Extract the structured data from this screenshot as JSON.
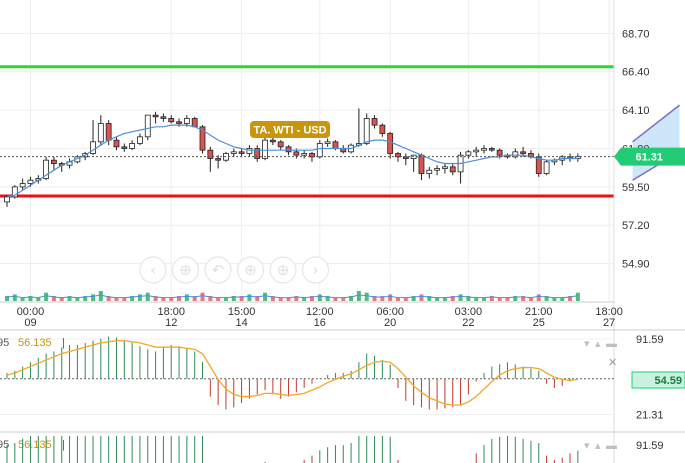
{
  "chart_data": {
    "type": "candlestick",
    "title": "TA. WTI - USD",
    "price_axis": {
      "ticks": [
        "68.70",
        "66.40",
        "64.10",
        "61.80",
        "59.50",
        "57.20",
        "54.90"
      ],
      "tick_values": [
        68.7,
        66.4,
        64.1,
        61.8,
        59.5,
        57.2,
        54.9
      ],
      "ylim": [
        52.6,
        70.7
      ],
      "current_price": "61.31",
      "current_value": 61.31
    },
    "time_axis": {
      "labels": [
        {
          "time": "00:00",
          "date": "09",
          "bar": 3
        },
        {
          "time": "18:00",
          "date": "12",
          "bar": 21
        },
        {
          "time": "15:00",
          "date": "14",
          "bar": 30
        },
        {
          "time": "12:00",
          "date": "16",
          "bar": 40
        },
        {
          "time": "06:00",
          "date": "20",
          "bar": 49
        },
        {
          "time": "03:00",
          "date": "22",
          "bar": 59
        },
        {
          "time": "21:00",
          "date": "25",
          "bar": 68
        },
        {
          "time": "18:00",
          "date": "27",
          "bar": 77
        }
      ]
    },
    "levels": [
      {
        "name": "resistance",
        "value": 66.7,
        "color": "#22dd22"
      },
      {
        "name": "support",
        "value": 58.95,
        "color": "#ee1111"
      }
    ],
    "candles": [
      [
        58.6,
        59.0,
        58.3,
        58.9
      ],
      [
        58.9,
        59.6,
        58.8,
        59.5
      ],
      [
        59.5,
        60.0,
        59.3,
        59.7
      ],
      [
        59.7,
        60.1,
        59.5,
        59.9
      ],
      [
        59.9,
        60.2,
        59.7,
        60.0
      ],
      [
        60.0,
        61.3,
        59.9,
        61.1
      ],
      [
        61.1,
        61.3,
        60.5,
        60.9
      ],
      [
        60.9,
        61.0,
        60.4,
        60.8
      ],
      [
        60.8,
        61.2,
        60.6,
        61.0
      ],
      [
        61.0,
        61.4,
        60.9,
        61.3
      ],
      [
        61.3,
        61.6,
        61.1,
        61.5
      ],
      [
        61.5,
        63.5,
        61.4,
        62.2
      ],
      [
        62.2,
        63.8,
        62.0,
        63.3
      ],
      [
        63.3,
        63.5,
        62.0,
        62.3
      ],
      [
        62.3,
        62.5,
        61.7,
        61.9
      ],
      [
        61.9,
        62.1,
        61.6,
        61.8
      ],
      [
        61.8,
        62.3,
        61.7,
        62.1
      ],
      [
        62.1,
        62.7,
        62.0,
        62.5
      ],
      [
        62.5,
        62.9,
        62.3,
        63.8
      ],
      [
        63.8,
        64.0,
        63.3,
        63.7
      ],
      [
        63.7,
        63.9,
        63.4,
        63.6
      ],
      [
        63.6,
        63.8,
        63.3,
        63.4
      ],
      [
        63.4,
        63.6,
        63.1,
        63.3
      ],
      [
        63.3,
        63.8,
        63.1,
        63.6
      ],
      [
        63.6,
        63.7,
        63.2,
        63.1
      ],
      [
        63.1,
        63.2,
        61.5,
        61.7
      ],
      [
        61.7,
        61.9,
        60.4,
        61.2
      ],
      [
        61.2,
        61.4,
        60.6,
        61.1
      ],
      [
        61.1,
        61.6,
        61.0,
        61.5
      ],
      [
        61.5,
        61.8,
        61.3,
        61.6
      ],
      [
        61.6,
        61.8,
        61.3,
        61.5
      ],
      [
        61.5,
        62.0,
        61.3,
        61.8
      ],
      [
        61.8,
        62.0,
        61.0,
        61.2
      ],
      [
        61.2,
        62.5,
        61.1,
        62.3
      ],
      [
        62.3,
        62.6,
        62.0,
        62.2
      ],
      [
        62.2,
        62.3,
        61.7,
        61.9
      ],
      [
        61.9,
        62.0,
        61.4,
        61.6
      ],
      [
        61.6,
        61.8,
        61.2,
        61.4
      ],
      [
        61.4,
        61.7,
        61.2,
        61.5
      ],
      [
        61.5,
        61.6,
        61.0,
        61.3
      ],
      [
        61.3,
        62.3,
        61.2,
        62.1
      ],
      [
        62.1,
        62.4,
        61.9,
        62.2
      ],
      [
        62.2,
        62.3,
        61.7,
        61.8
      ],
      [
        61.8,
        62.0,
        61.5,
        61.6
      ],
      [
        61.6,
        62.1,
        61.5,
        62.0
      ],
      [
        62.0,
        64.2,
        61.9,
        62.1
      ],
      [
        62.1,
        63.9,
        62.0,
        63.6
      ],
      [
        63.6,
        63.8,
        63.0,
        63.2
      ],
      [
        63.2,
        63.3,
        62.5,
        62.7
      ],
      [
        62.7,
        62.8,
        61.2,
        61.5
      ],
      [
        61.5,
        61.6,
        61.0,
        61.3
      ],
      [
        61.3,
        61.5,
        60.8,
        61.2
      ],
      [
        61.2,
        61.4,
        60.4,
        61.4
      ],
      [
        61.4,
        61.5,
        59.9,
        60.3
      ],
      [
        60.3,
        60.7,
        60.0,
        60.5
      ],
      [
        60.5,
        60.8,
        60.2,
        60.6
      ],
      [
        60.6,
        60.9,
        60.3,
        60.7
      ],
      [
        60.7,
        60.9,
        60.2,
        60.4
      ],
      [
        60.4,
        61.6,
        59.7,
        61.4
      ],
      [
        61.4,
        61.7,
        61.2,
        61.6
      ],
      [
        61.6,
        61.9,
        61.3,
        61.7
      ],
      [
        61.7,
        62.0,
        61.5,
        61.8
      ],
      [
        61.8,
        61.9,
        61.6,
        61.7
      ],
      [
        61.7,
        61.8,
        61.2,
        61.4
      ],
      [
        61.4,
        61.5,
        61.2,
        61.3
      ],
      [
        61.3,
        61.8,
        61.2,
        61.6
      ],
      [
        61.6,
        61.9,
        61.3,
        61.5
      ],
      [
        61.5,
        61.7,
        61.2,
        61.3
      ],
      [
        61.3,
        61.5,
        60.1,
        60.3
      ],
      [
        60.3,
        61.1,
        60.2,
        61.0
      ],
      [
        61.0,
        61.2,
        60.8,
        61.1
      ],
      [
        61.1,
        61.4,
        60.8,
        61.3
      ],
      [
        61.3,
        61.5,
        61.0,
        61.2
      ],
      [
        61.2,
        61.5,
        61.0,
        61.31
      ]
    ],
    "moving_average": [
      58.9,
      59.0,
      59.3,
      59.6,
      59.9,
      60.2,
      60.5,
      60.8,
      61.0,
      61.2,
      61.4,
      61.7,
      62.0,
      62.3,
      62.5,
      62.7,
      62.8,
      62.9,
      63.0,
      63.1,
      63.1,
      63.2,
      63.2,
      63.2,
      63.1,
      62.9,
      62.6,
      62.3,
      62.1,
      61.9,
      61.8,
      61.7,
      61.7,
      61.7,
      61.7,
      61.7,
      61.7,
      61.7,
      61.7,
      61.7,
      61.8,
      61.8,
      61.8,
      61.8,
      61.8,
      62.0,
      62.2,
      62.3,
      62.3,
      62.2,
      62.0,
      61.8,
      61.6,
      61.4,
      61.2,
      61.0,
      60.9,
      60.9,
      60.9,
      61.0,
      61.1,
      61.2,
      61.3,
      61.3,
      61.4,
      61.4,
      61.4,
      61.3,
      61.2,
      61.1,
      61.1,
      61.2,
      61.2,
      61.2
    ],
    "channel": {
      "from_bar": 80,
      "to_bar": 86,
      "upper": [
        62.2,
        64.4
      ],
      "lower": [
        59.9,
        61.6
      ]
    },
    "volume": [
      3,
      4,
      2,
      3,
      2,
      5,
      3,
      2,
      3,
      2,
      3,
      4,
      6,
      3,
      2,
      2,
      3,
      4,
      5,
      3,
      2,
      2,
      3,
      4,
      3,
      5,
      3,
      2,
      2,
      3,
      3,
      4,
      3,
      5,
      3,
      2,
      2,
      3,
      2,
      3,
      4,
      3,
      2,
      2,
      3,
      6,
      5,
      3,
      3,
      4,
      2,
      2,
      3,
      4,
      3,
      2,
      2,
      3,
      4,
      3,
      2,
      2,
      3,
      2,
      2,
      3,
      3,
      2,
      4,
      3,
      2,
      2,
      3,
      5
    ],
    "oscillator": {
      "label": "56.135",
      "current": "54.59",
      "current_value": 54.59,
      "ticks": [
        "91.59",
        "21.31"
      ],
      "tick_values": [
        91.59,
        21.31
      ],
      "ylim": [
        5,
        100
      ],
      "baseline": 54.59,
      "values": [
        60,
        62,
        66,
        70,
        74,
        78,
        80,
        84,
        86,
        86,
        88,
        90,
        92,
        94,
        93,
        91,
        88,
        85,
        82,
        80,
        84,
        86,
        85,
        83,
        80,
        70,
        38,
        30,
        26,
        28,
        32,
        36,
        40,
        44,
        40,
        36,
        38,
        42,
        46,
        50,
        55,
        58,
        60,
        60,
        62,
        70,
        78,
        76,
        72,
        68,
        46,
        34,
        30,
        28,
        26,
        26,
        27,
        28,
        30,
        40,
        52,
        60,
        66,
        68,
        70,
        68,
        66,
        64,
        62,
        50,
        46,
        48,
        52,
        54.59
      ],
      "signal": [
        58,
        60,
        63,
        66,
        69,
        72,
        75,
        78,
        80,
        82,
        84,
        86,
        88,
        89,
        90,
        90,
        89,
        88,
        86,
        84,
        84,
        84,
        84,
        83,
        82,
        78,
        66,
        54,
        45,
        40,
        38,
        38,
        39,
        41,
        41,
        40,
        39,
        40,
        41,
        44,
        47,
        51,
        54,
        57,
        59,
        63,
        67,
        70,
        71,
        70,
        64,
        56,
        48,
        42,
        37,
        34,
        31,
        30,
        30,
        33,
        38,
        45,
        52,
        58,
        62,
        64,
        65,
        65,
        64,
        60,
        56,
        54,
        53,
        54
      ]
    },
    "oscillator2": {
      "label": "56.135",
      "ticks": [
        "91.59"
      ],
      "tick_values": [
        91.59
      ]
    },
    "colors": {
      "up": "#2e8b57",
      "down": "#d9534f",
      "ma": "#4a90d9",
      "osc_line": "#f5a623",
      "price_tag": "#22cc77",
      "title_tag": "#c8960c"
    },
    "icons": [
      "zoom-out-icon",
      "zoom-in-icon",
      "back-icon",
      "forward-icon",
      "next-icon",
      "next-icon"
    ]
  }
}
